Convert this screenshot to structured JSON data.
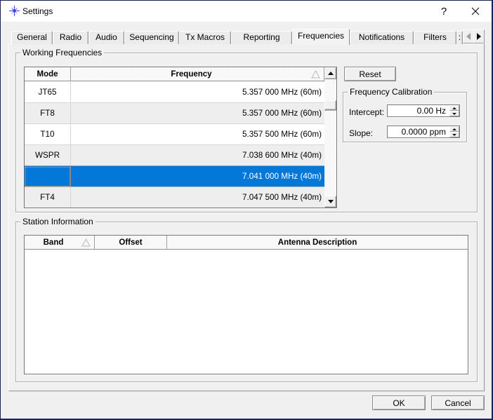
{
  "window": {
    "title": "Settings",
    "help_glyph": "?",
    "close_glyph": "✕"
  },
  "colors": {
    "selection_blue": "#0c7cd5",
    "window_border": "#1a2453",
    "titlebar_bg": "#ffffff",
    "dialog_bg": "#f0f0f0"
  },
  "tabs": {
    "items": [
      {
        "label": "General",
        "selected": false
      },
      {
        "label": "Radio",
        "selected": false
      },
      {
        "label": "Audio",
        "selected": false
      },
      {
        "label": "Sequencing",
        "selected": false
      },
      {
        "label": "Tx Macros",
        "selected": false
      },
      {
        "label": "Reporting",
        "selected": false
      },
      {
        "label": "Frequencies",
        "selected": true
      },
      {
        "label": "Notifications",
        "selected": false
      },
      {
        "label": "Filters",
        "selected": false
      }
    ],
    "overflow_partial_label": ":",
    "scroll_left_icon": "left-arrow",
    "scroll_right_icon": "right-arrow"
  },
  "working_frequencies": {
    "group_label": "Working Frequencies",
    "reset_button": "Reset",
    "table": {
      "columns": [
        "Mode",
        "Frequency"
      ],
      "sort_column": "Frequency",
      "rows": [
        {
          "mode": "JT65",
          "frequency": "5.357 000 MHz (60m)",
          "selected": false
        },
        {
          "mode": "FT8",
          "frequency": "5.357 000 MHz (60m)",
          "selected": false
        },
        {
          "mode": "T10",
          "frequency": "5.357 500 MHz (60m)",
          "selected": false
        },
        {
          "mode": "WSPR",
          "frequency": "7.038 600 MHz (40m)",
          "selected": false
        },
        {
          "mode": "",
          "frequency": "7.041 000 MHz (40m)",
          "selected": true
        },
        {
          "mode": "FT4",
          "frequency": "7.047 500 MHz (40m)",
          "selected": false
        }
      ]
    }
  },
  "frequency_calibration": {
    "group_label": "Frequency Calibration",
    "intercept_label": "Intercept:",
    "intercept_value": "0.00 Hz",
    "slope_label": "Slope:",
    "slope_value": "0.0000 ppm"
  },
  "station_information": {
    "group_label": "Station Information",
    "columns": [
      "Band",
      "Offset",
      "Antenna Description"
    ],
    "sort_column": "Band",
    "rows": []
  },
  "dialog_buttons": {
    "ok": "OK",
    "cancel": "Cancel"
  }
}
